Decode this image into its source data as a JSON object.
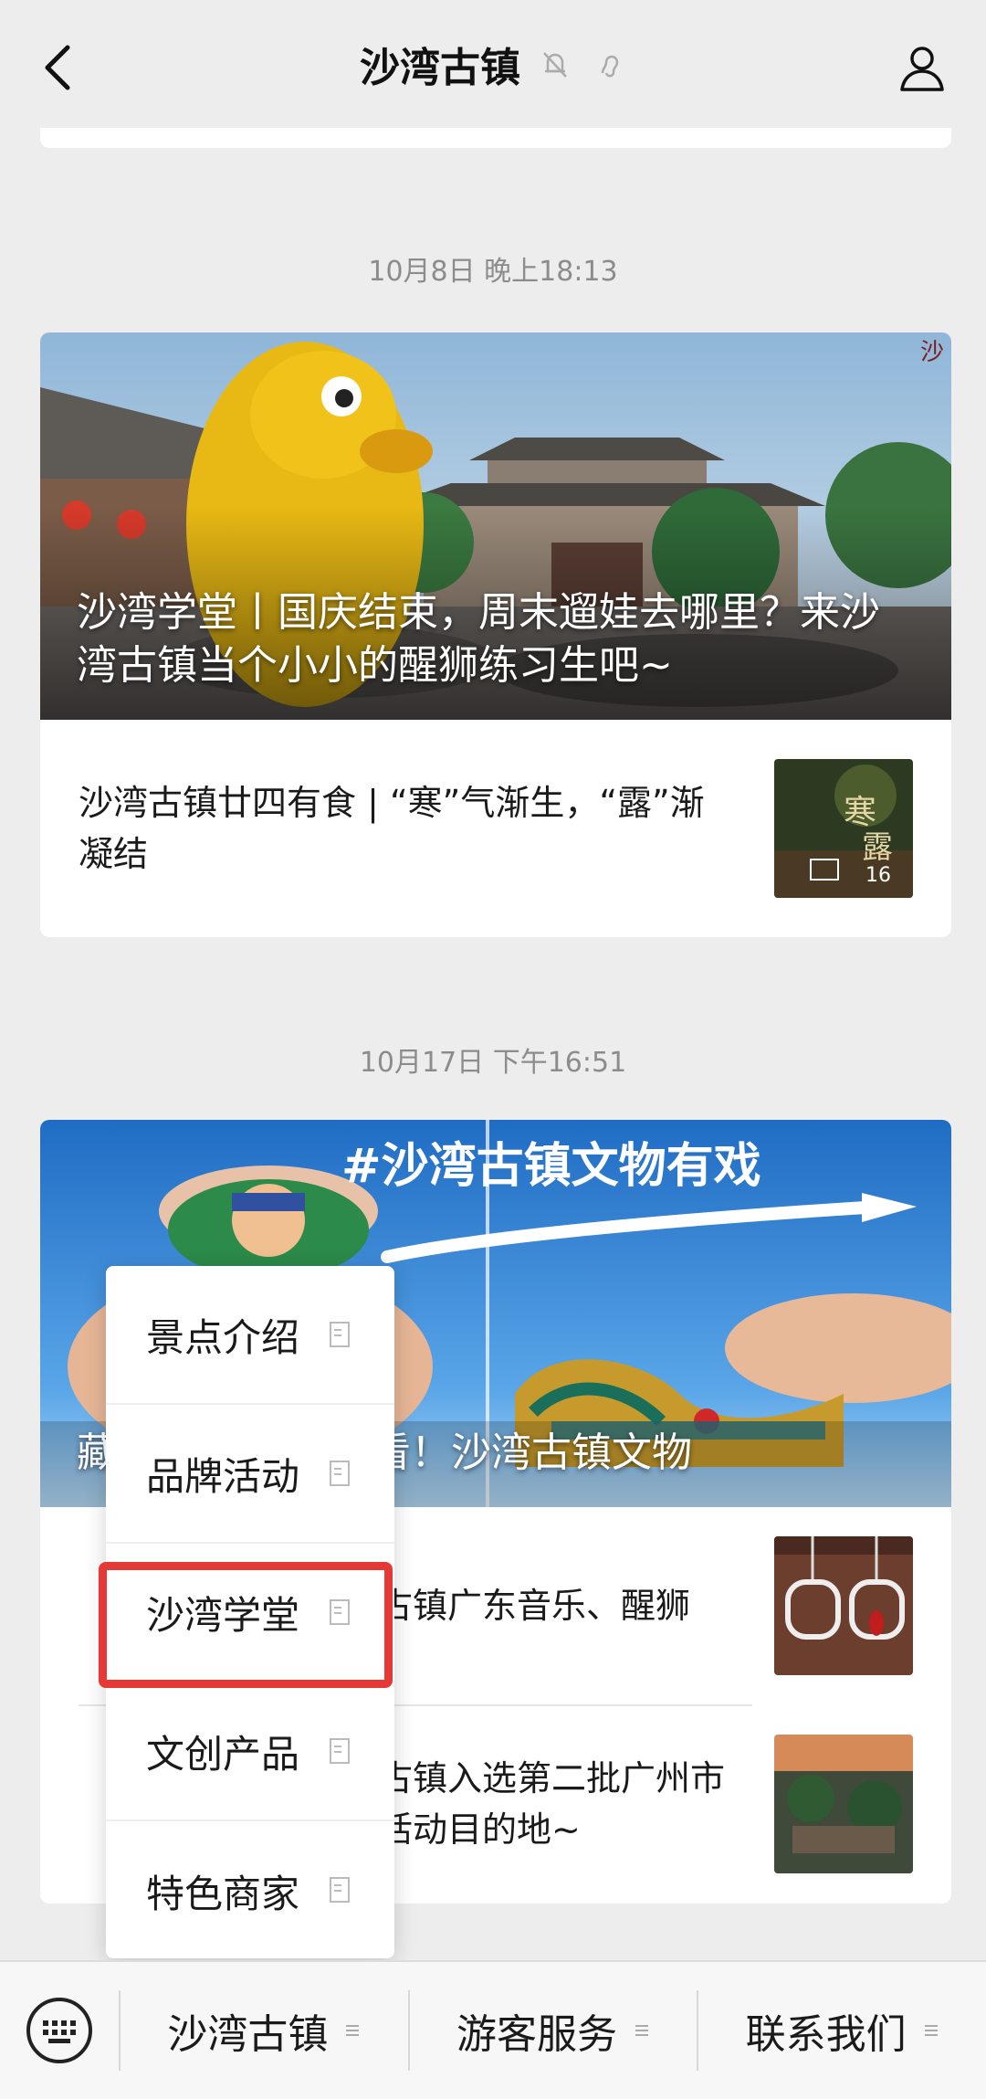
{
  "header": {
    "title": "沙湾古镇"
  },
  "timeline": [
    {
      "timestamp": "10月8日 晚上18:13",
      "hero_title": "沙湾学堂丨国庆结束，周末遛娃去哪里？来沙湾古镇当个小小的醒狮练习生吧~",
      "sub_items": [
        {
          "text": "沙湾古镇廿四有食 | “寒”气渐生，“露”渐凝结"
        }
      ]
    },
    {
      "timestamp": "10月17日 下午16:51",
      "hero_title": "藏 向右啦，向这看！沙湾古镇文物",
      "hero_banner": "#沙湾古镇文物有戏",
      "sub_items": [
        {
          "text": "古镇广东音乐、醒狮"
        },
        {
          "text": "古镇入选第二批广州市活动目的地~"
        }
      ]
    }
  ],
  "popup_menu": {
    "items": [
      "景点介绍",
      "品牌活动",
      "沙湾学堂",
      "文创产品",
      "特色商家"
    ],
    "highlighted_index": 2
  },
  "bottom_bar": {
    "items": [
      "沙湾古镇",
      "游客服务",
      "联系我们"
    ]
  }
}
